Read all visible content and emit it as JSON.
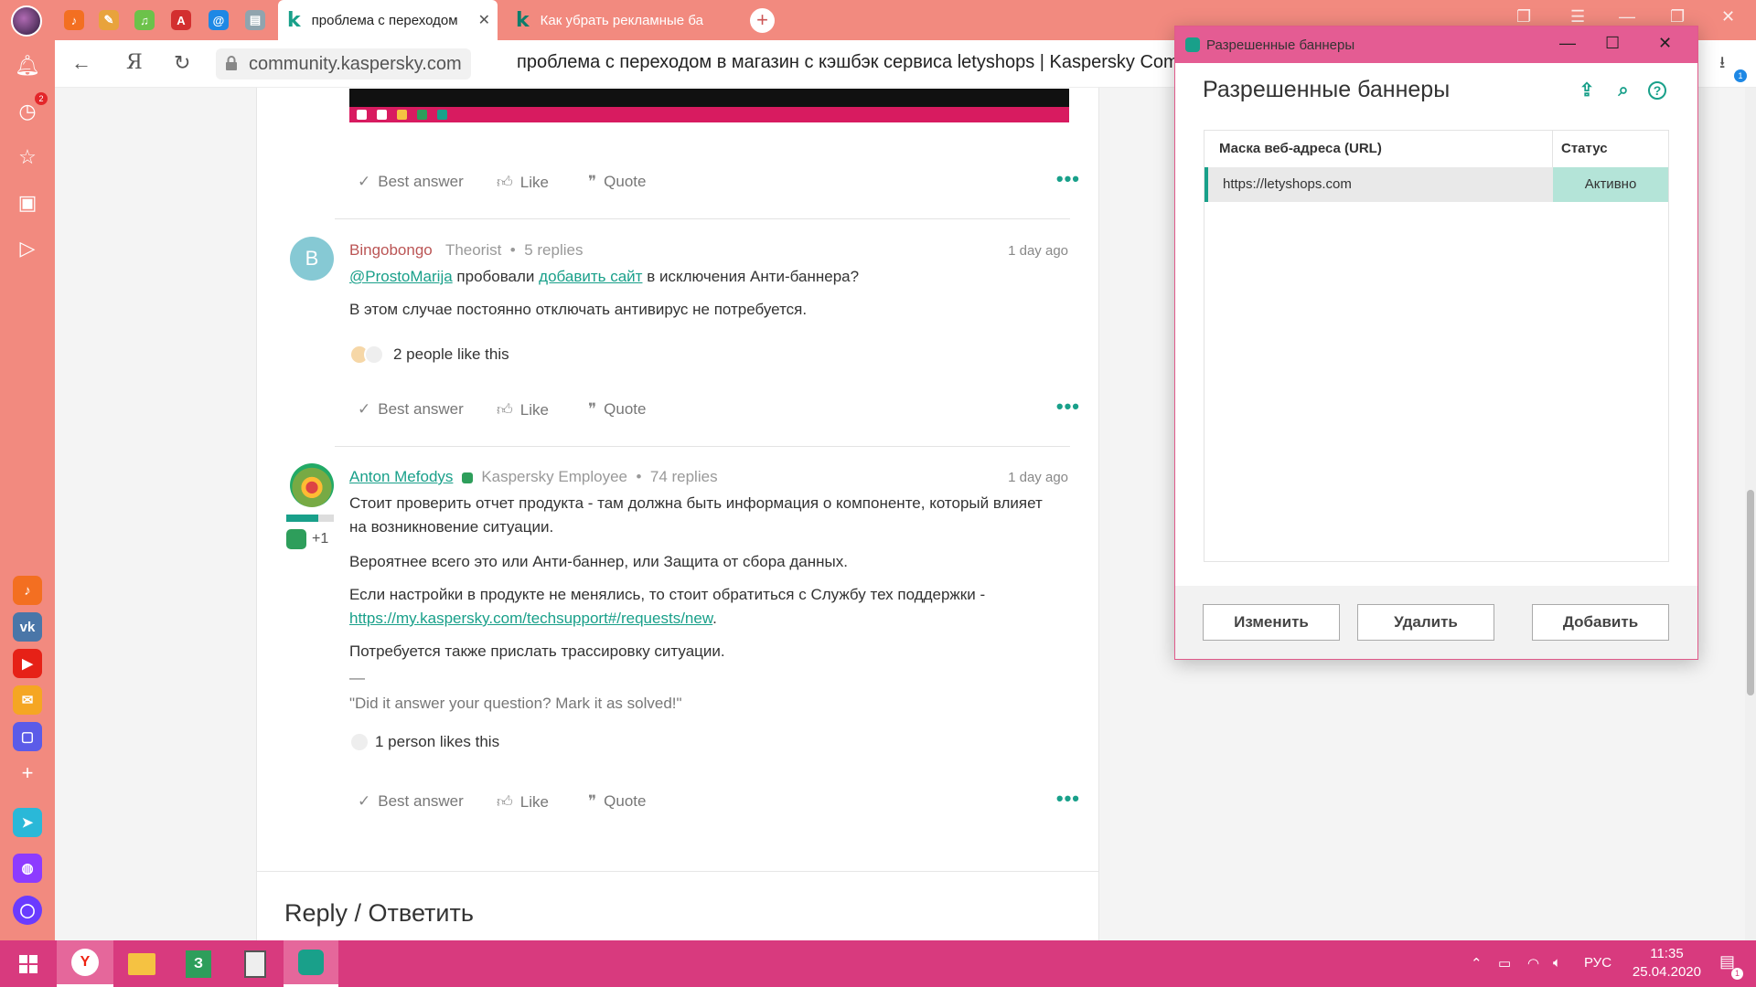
{
  "browser": {
    "tabs": [
      {
        "title": "проблема с переходом"
      },
      {
        "title": "Как убрать рекламные ба"
      }
    ],
    "url": "community.kaspersky.com",
    "page_title": "проблема с переходом в магазин с кэшбэк сервиса letyshops | Kaspersky Comm",
    "notification_count": "2",
    "downloads_count": "1",
    "omnibox_logo": "Я"
  },
  "actions": {
    "best_answer": "Best answer",
    "like": "Like",
    "quote": "Quote",
    "more": "•••"
  },
  "posts": [
    {
      "avatar_letter": "B",
      "author": "Bingobongo",
      "rank": "Theorist",
      "replies": "5 replies",
      "time": "1 day ago",
      "mention": "@ProstoMarija",
      "text_a": " пробовали ",
      "link": "добавить сайт",
      "text_b": " в исключения Анти-баннера?",
      "p2": "В этом случае постоянно отключать антивирус не потребуется.",
      "likes": "2 people like this"
    },
    {
      "author": "Anton Mefodys",
      "rank": "Kaspersky Employee",
      "replies": "74 replies",
      "time": "1 day ago",
      "badge_count": "+1",
      "p1": "Стоит проверить отчет продукта - там должна быть информация о компоненте, который влияет на возникновение ситуации.",
      "p2": "Вероятнее всего это или  Анти-баннер, или Защита от сбора данных.",
      "p3": "Если настройки в продукте не менялись, то стоит обратиться с Службу тех поддержки -",
      "p3_link": "https://my.kaspersky.com/techsupport#/requests/new",
      "p3_end": ".",
      "p4": "Потребуется также прислать трассировку ситуации.",
      "sig_rule": "—",
      "signature": "\"Did it answer your question? Mark it as solved!\"",
      "likes": "1 person likes this"
    }
  ],
  "reply_heading": "Reply / Ответить",
  "dialog": {
    "window_title": "Разрешенные баннеры",
    "heading": "Разрешенные баннеры",
    "col_url": "Маска веб-адреса (URL)",
    "col_status": "Статус",
    "rows": [
      {
        "url": "https://letyshops.com",
        "status": "Активно"
      }
    ],
    "buttons": {
      "edit": "Изменить",
      "delete": "Удалить",
      "add": "Добавить"
    }
  },
  "taskbar": {
    "lang": "РУС",
    "time": "11:35",
    "date": "25.04.2020",
    "notify_count": "1"
  },
  "colors": {
    "accent": "#19a08a",
    "browser_chrome": "#f28a7f",
    "taskbar": "#d83a7e",
    "dialog_title": "#e45c93",
    "status_active_bg": "#b4e4d8"
  }
}
